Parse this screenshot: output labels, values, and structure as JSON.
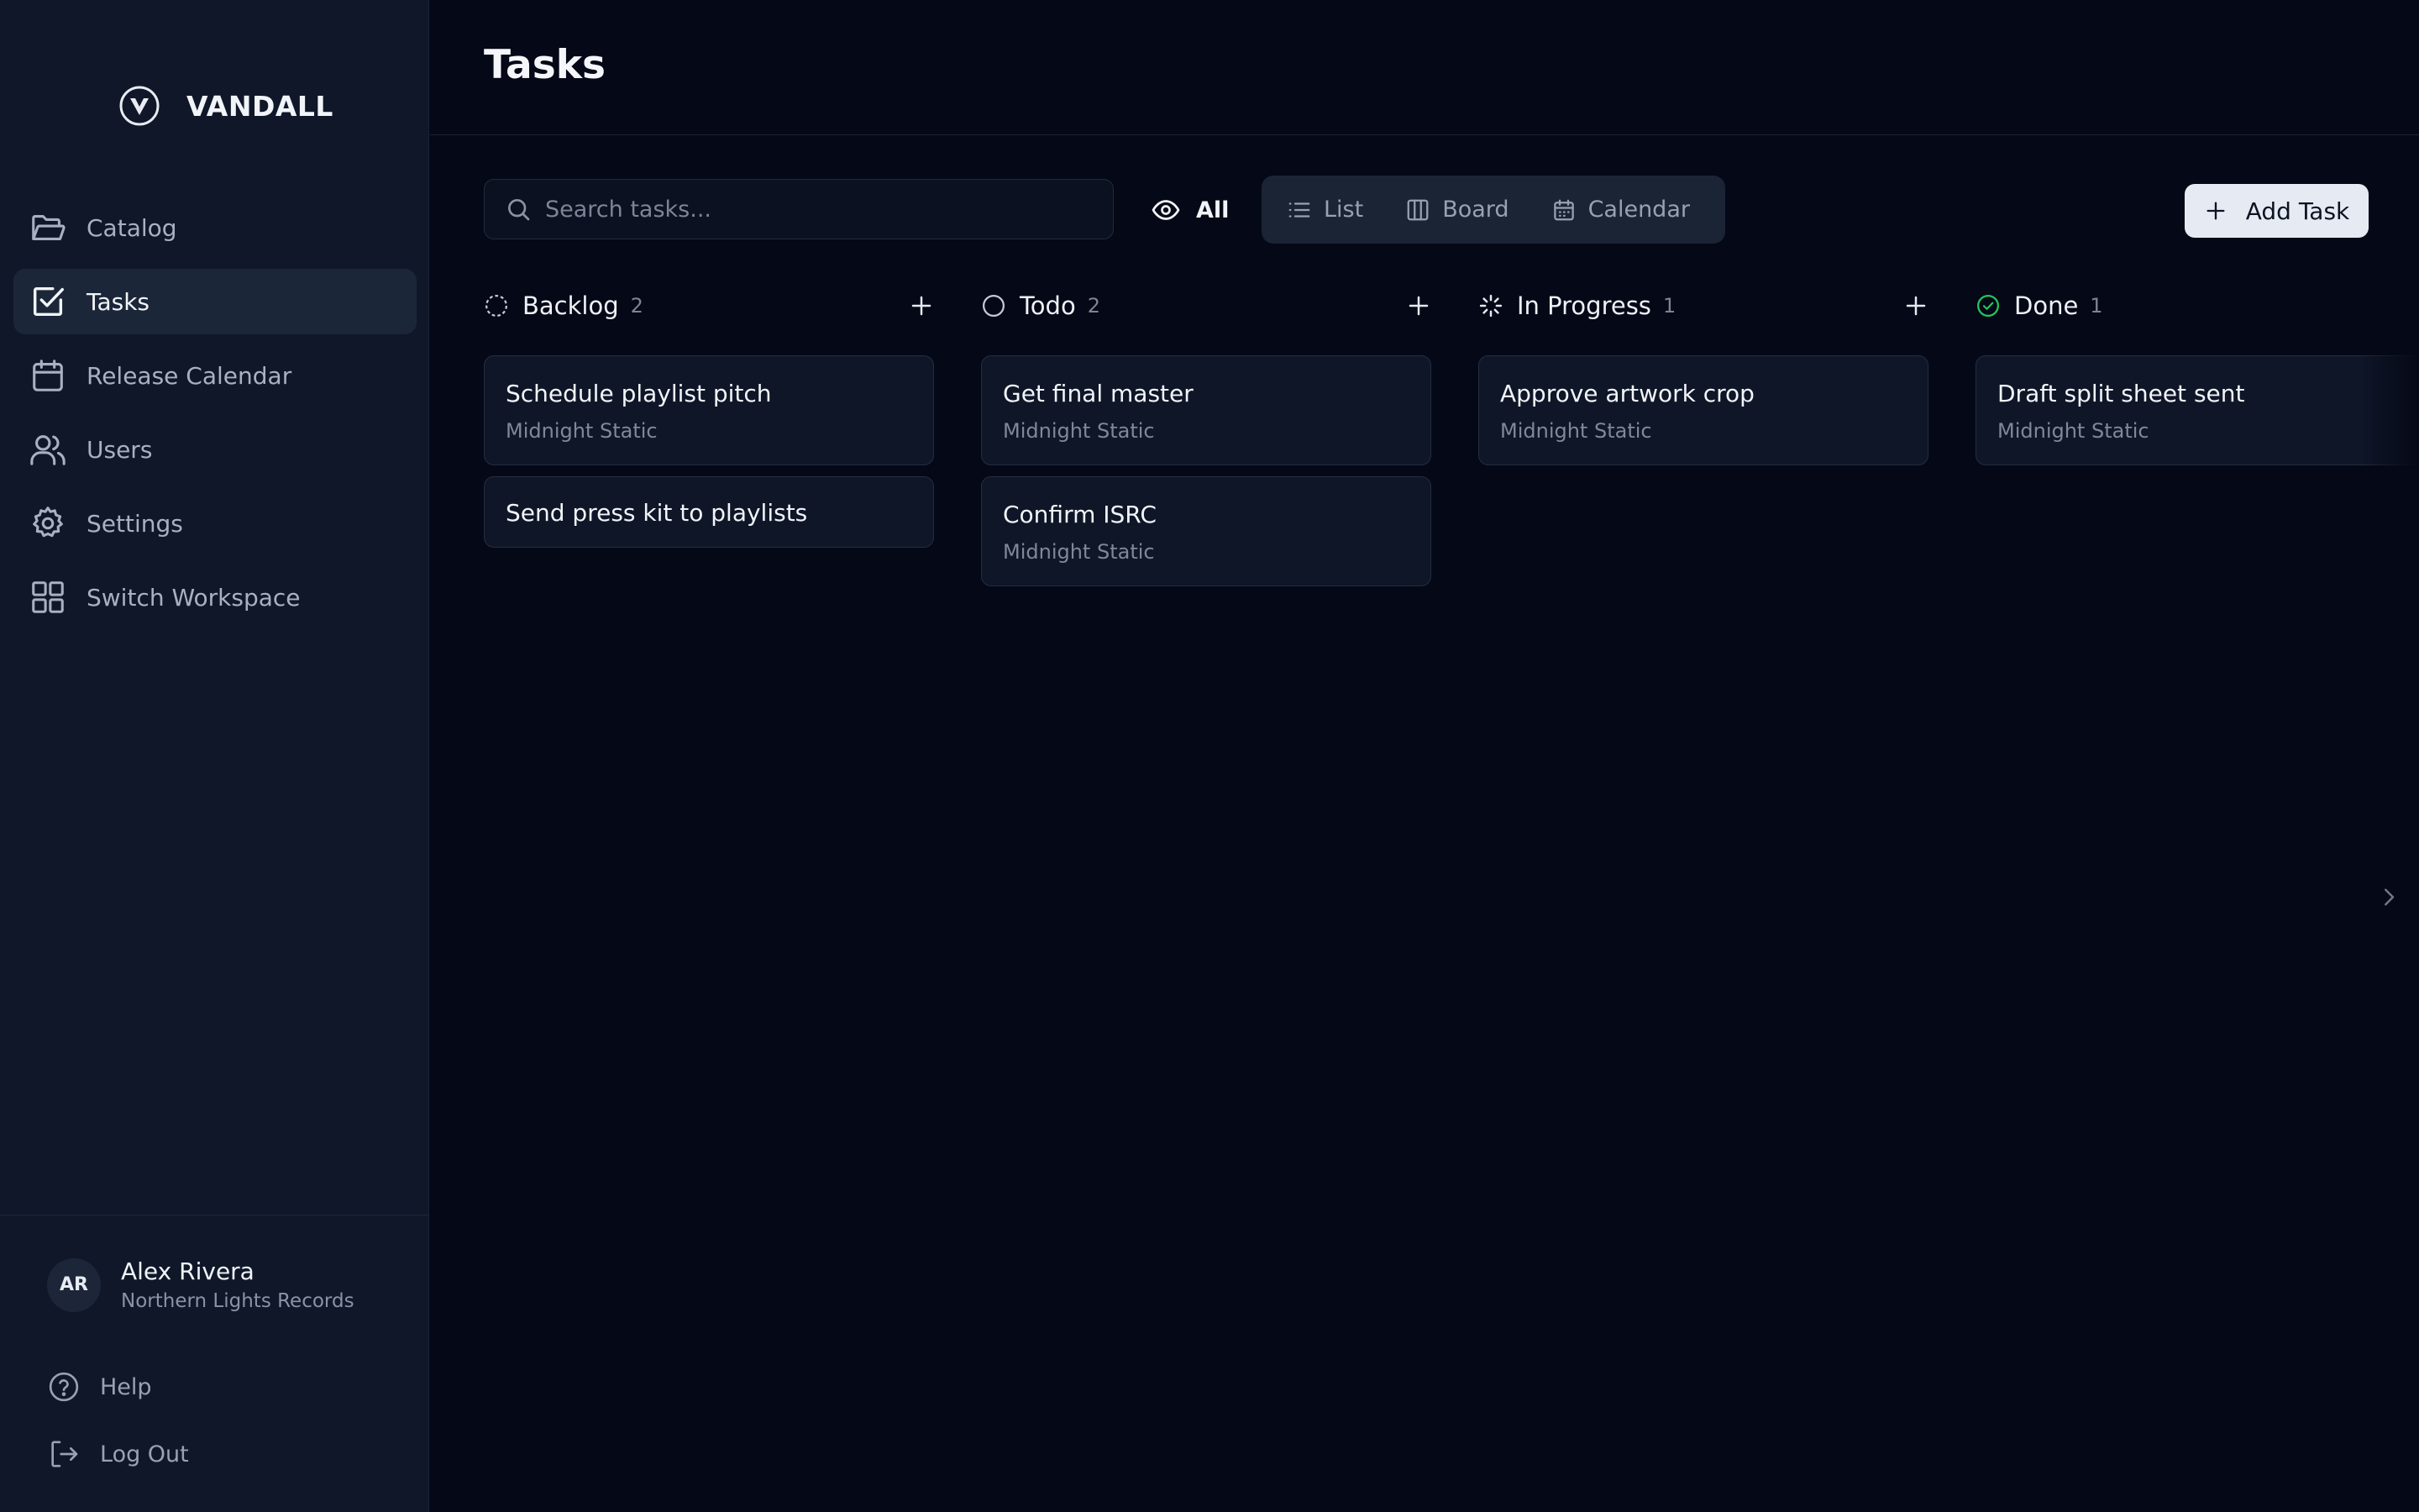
{
  "app": {
    "logo_text": "VANDALL"
  },
  "sidebar": {
    "items": [
      {
        "label": "Catalog",
        "icon": "folder-open-icon"
      },
      {
        "label": "Tasks",
        "icon": "checkbox-icon",
        "active": true
      },
      {
        "label": "Release Calendar",
        "icon": "calendar-icon"
      },
      {
        "label": "Users",
        "icon": "users-icon"
      },
      {
        "label": "Settings",
        "icon": "gear-icon"
      },
      {
        "label": "Switch Workspace",
        "icon": "grid-icon"
      }
    ],
    "user": {
      "initials": "AR",
      "name": "Alex Rivera",
      "org": "Northern Lights Records"
    },
    "footer": {
      "help": "Help",
      "logout": "Log Out"
    }
  },
  "header": {
    "title": "Tasks"
  },
  "toolbar": {
    "search_placeholder": "Search tasks...",
    "filter_label": "All",
    "views": [
      "List",
      "Board",
      "Calendar"
    ],
    "add_label": "Add Task"
  },
  "columns": [
    {
      "name": "Backlog",
      "count": "2",
      "status_icon": "dashed-circle-icon",
      "cards": [
        {
          "title": "Schedule playlist pitch",
          "subtitle": "Midnight Static"
        },
        {
          "title": "Send press kit to playlists",
          "subtitle": ""
        }
      ]
    },
    {
      "name": "Todo",
      "count": "2",
      "status_icon": "circle-icon",
      "cards": [
        {
          "title": "Get final master",
          "subtitle": "Midnight Static"
        },
        {
          "title": "Confirm ISRC",
          "subtitle": "Midnight Static"
        }
      ]
    },
    {
      "name": "In Progress",
      "count": "1",
      "status_icon": "loader-icon",
      "cards": [
        {
          "title": "Approve artwork crop",
          "subtitle": "Midnight Static"
        }
      ]
    },
    {
      "name": "Done",
      "count": "1",
      "status_icon": "check-circle-icon",
      "cards": [
        {
          "title": "Draft split sheet sent",
          "subtitle": "Midnight Static"
        }
      ]
    }
  ],
  "colors": {
    "background": "#050816",
    "sidebar": "#0f1729",
    "done_accent": "#22c55e"
  }
}
